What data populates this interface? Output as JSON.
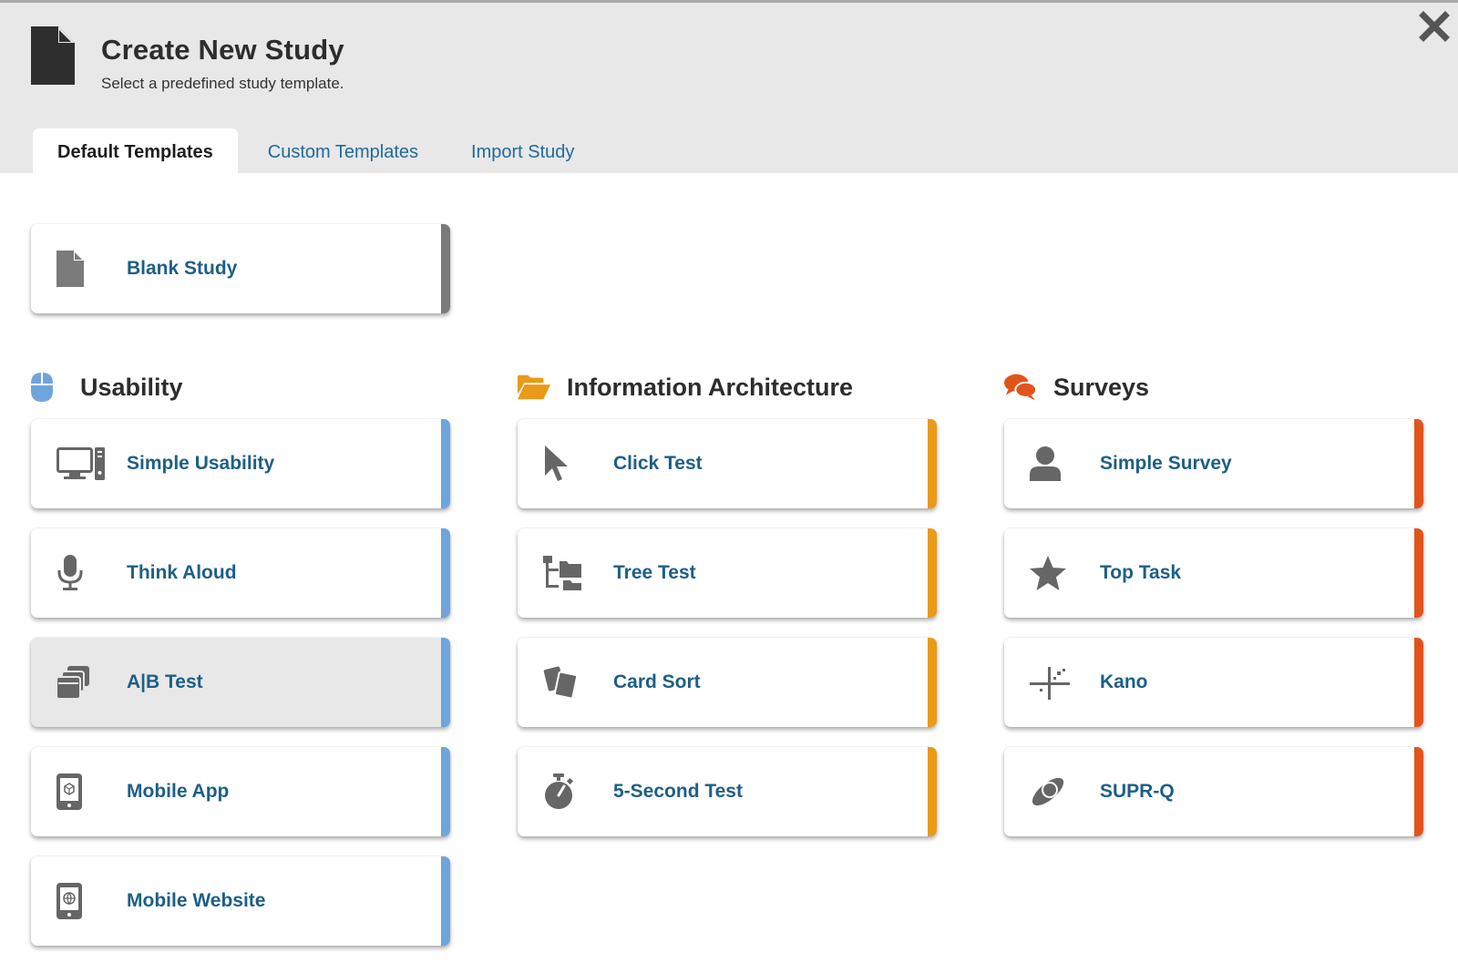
{
  "header": {
    "title": "Create New Study",
    "subtitle": "Select a predefined study template.",
    "icon": "document-icon",
    "close_icon": "close-icon"
  },
  "tabs": [
    {
      "label": "Default Templates",
      "active": true
    },
    {
      "label": "Custom Templates",
      "active": false
    },
    {
      "label": "Import Study",
      "active": false
    }
  ],
  "blank": {
    "label": "Blank Study",
    "icon": "file-icon",
    "accent": "#7a7a7a"
  },
  "sections": [
    {
      "title": "Usability",
      "icon": "mouse-icon",
      "accent": "#6fa5dc",
      "items": [
        {
          "label": "Simple Usability",
          "icon": "desktop-computer-icon"
        },
        {
          "label": "Think Aloud",
          "icon": "microphone-icon"
        },
        {
          "label": "A|B Test",
          "icon": "window-stack-icon"
        },
        {
          "label": "Mobile App",
          "icon": "mobile-app-icon"
        },
        {
          "label": "Mobile Website",
          "icon": "mobile-web-icon"
        }
      ]
    },
    {
      "title": "Information Architecture",
      "icon": "folder-open-icon",
      "accent": "#e99a18",
      "items": [
        {
          "label": "Click Test",
          "icon": "cursor-icon"
        },
        {
          "label": "Tree Test",
          "icon": "tree-icon"
        },
        {
          "label": "Card Sort",
          "icon": "cards-icon"
        },
        {
          "label": "5-Second Test",
          "icon": "stopwatch-icon"
        }
      ]
    },
    {
      "title": "Surveys",
      "icon": "chat-bubbles-icon",
      "accent": "#e0541c",
      "items": [
        {
          "label": "Simple Survey",
          "icon": "user-icon"
        },
        {
          "label": "Top Task",
          "icon": "star-icon"
        },
        {
          "label": "Kano",
          "icon": "kano-axes-icon"
        },
        {
          "label": "SUPR-Q",
          "icon": "planet-icon"
        }
      ]
    }
  ]
}
